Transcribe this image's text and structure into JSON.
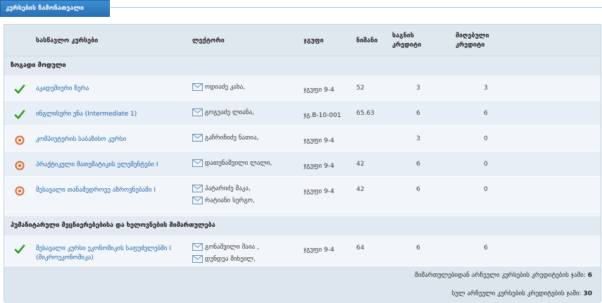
{
  "panel": {
    "title": "კურსების ჩამონათვალი"
  },
  "columns": {
    "course": "სასწავლო კურსები",
    "lecturer": "ლექტორი",
    "group": "ჯგუფი",
    "grade": "ნიშანი",
    "credits_line1": "საგნის",
    "credits_line2": "კრედიტი",
    "earned_line1": "მიღებული",
    "earned_line2": "კრედიტი"
  },
  "sections": [
    {
      "title": "ზოგადი მოდული",
      "rows": [
        {
          "status": "passed",
          "course": "აკადემიური წერა",
          "lecturers": [
            "ოდიაძე კახა,"
          ],
          "group": "ჯგუფი 9-4",
          "grade": "52",
          "credits": "3",
          "earned": "3"
        },
        {
          "status": "passed",
          "course": "ინგლისური ენა (Intermediate 1)",
          "lecturers": [
            "გოგუაძე ლიანა,"
          ],
          "group": "ჯგ.B-10-001",
          "grade": "65.63",
          "credits": "6",
          "earned": "6"
        },
        {
          "status": "in-progress",
          "course": "კომპიუტერის საბაზისო კურსი",
          "lecturers": [
            "გაჩრიჩიძე ნათია,"
          ],
          "group": "ჯგუფი 9-4",
          "grade": "",
          "credits": "3",
          "earned": "0"
        },
        {
          "status": "in-progress",
          "course": "პრაქტიკული მათემატიკის ელემენტები I",
          "lecturers": [
            "დათუნაშვილი ლალი,"
          ],
          "group": "ჯგუფი 9-4",
          "grade": "42",
          "credits": "6",
          "earned": "0"
        },
        {
          "status": "in-progress",
          "course": "შესავალი თანამედროვე აზროვნებაში I",
          "lecturers": [
            "პატარიძე შაკა,",
            "რატიანი სერგო,"
          ],
          "group": "ჯგუფი 9-4",
          "grade": "42",
          "credits": "6",
          "earned": "0"
        }
      ]
    },
    {
      "title": "ჰუმანიტარული მეცნიერებებისა და ხელოვნების მიმართულება",
      "rows": [
        {
          "status": "passed",
          "course": "შესავალი კურსი ეკონომიკის საფუძვლებში I (მიკროეკონომიკა)",
          "lecturers": [
            "გონაშვილი მაია ,",
            "დუნდუა მიხეილ,"
          ],
          "group": "ჯგუფი 9-4",
          "grade": "64",
          "credits": "6",
          "earned": "6"
        }
      ]
    }
  ],
  "footer": {
    "direction_label": "მიმართულებიდან არჩეული კურსების კრედიტების ჯამი:",
    "direction_value": "6",
    "total_label": "სულ არჩეული კურსების კრედიტების ჯამი:",
    "total_value": "30"
  },
  "colors": {
    "passed": "#2e9a1e",
    "in_progress": "#e0662a",
    "link": "#1a5fa8"
  },
  "icons": {
    "passed": "checkmark-icon",
    "in_progress": "target-circle-icon",
    "lecturer": "mail-icon"
  }
}
